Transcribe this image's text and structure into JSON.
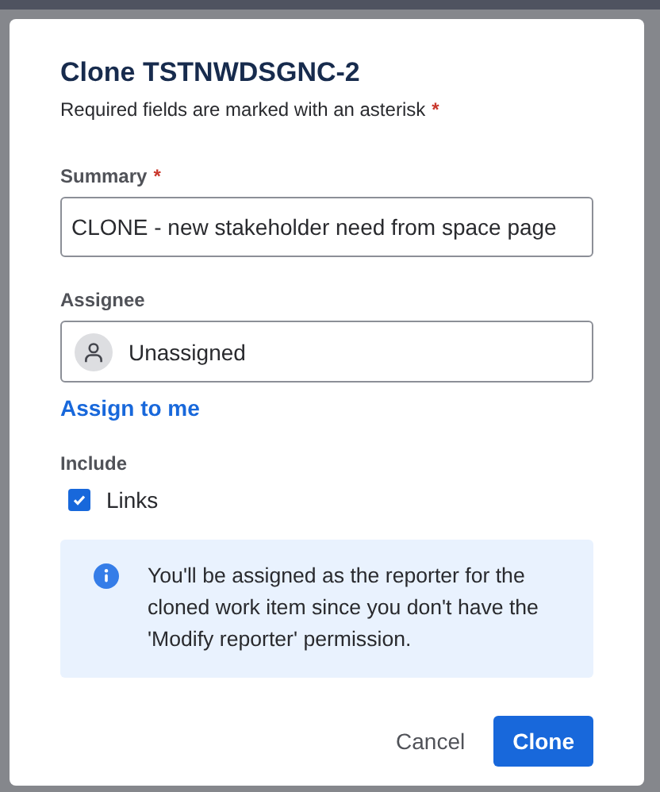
{
  "dialog": {
    "title": "Clone TSTNWDSGNC-2",
    "subtitle": "Required fields are marked with an asterisk",
    "required_mark": "*"
  },
  "summary": {
    "label": "Summary",
    "required": true,
    "value": "CLONE - new stakeholder need from space page"
  },
  "assignee": {
    "label": "Assignee",
    "required": false,
    "value": "Unassigned",
    "link": "Assign to me"
  },
  "include": {
    "label": "Include",
    "options": [
      {
        "label": "Links",
        "checked": true
      }
    ]
  },
  "info": {
    "text": "You'll be assigned as the reporter for the cloned work item since you don't have the 'Modify reporter' permission."
  },
  "buttons": [
    {
      "label": "Cancel",
      "kind": "subtle"
    },
    {
      "label": "Clone",
      "kind": "primary"
    }
  ]
}
